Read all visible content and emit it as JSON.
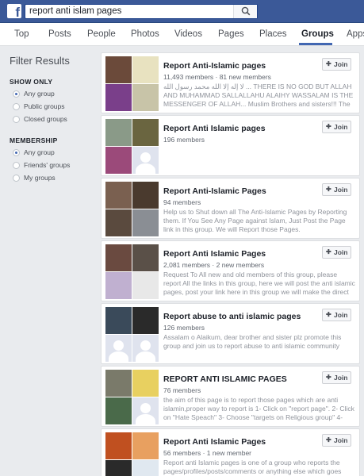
{
  "header": {
    "logo": "f",
    "search_value": "report anti islam pages"
  },
  "tabs": [
    "Top",
    "Posts",
    "People",
    "Photos",
    "Videos",
    "Pages",
    "Places",
    "Groups",
    "Apps"
  ],
  "active_tab": "Groups",
  "sidebar": {
    "title": "Filter Results",
    "show_only": {
      "heading": "SHOW ONLY",
      "options": [
        "Any group",
        "Public groups",
        "Closed groups"
      ],
      "selected": "Any group"
    },
    "membership": {
      "heading": "MEMBERSHIP",
      "options": [
        "Any group",
        "Friends' groups",
        "My groups"
      ],
      "selected": "Any group"
    }
  },
  "join_label": "Join",
  "results": [
    {
      "title": "Report Anti-Islamic pages",
      "meta": "11,493 members · 81 new members",
      "description": "لا إله إلا الله محمد رسول الله ... THERE IS NO GOD BUT ALLAH AND MUHAMMAD SALLALLAHU ALAIHY WASSALAM IS THE MESSENGER OF ALLAH... Muslim Brothers and sisters!!! The Mai...",
      "thumbs": [
        "#6b4a3a",
        "#e8e2c0",
        "#7a3f8a",
        "#c8c4a8"
      ]
    },
    {
      "title": "Report Anti Islamic pages",
      "meta": "196 members",
      "description": "",
      "thumbs": [
        "#8a9a88",
        "#6a6540",
        "#9b4a7a",
        "silhouette"
      ]
    },
    {
      "title": "Report Anti-Islamic Pages",
      "meta": "94 members",
      "description": "Help us to Shut down all The Anti-Islamic Pages by Reporting them. If You See Any Page against Islam, Just Post the Page link in this group. We will Report those Pages.",
      "thumbs": [
        "#7a6050",
        "#4a3a2e",
        "#5a4a3e",
        "#8a8e94"
      ]
    },
    {
      "title": "Report Anti Islamic Pages",
      "meta": "2,081 members · 2 new members",
      "description": "Request To All new and old members of this group, please report All the links in this group, here we will post the anti islamic pages, post your link here in this group we will make the direct report link ...",
      "thumbs": [
        "#6a4a40",
        "#5a5048",
        "#c0b0d0",
        "#e8e8e8"
      ]
    },
    {
      "title": "Report abuse to anti islamic pages",
      "meta": "126 members",
      "description": "Assalam o Alaikum, dear brother and sister plz promote this group and join us to report abuse to anti islamic community",
      "thumbs": [
        "#3a4a5a",
        "#2a2a2a",
        "silhouette",
        "silhouette"
      ]
    },
    {
      "title": "REPORT ANTI ISLAMIC PAGES",
      "meta": "76 members",
      "description": "the aim of this page is to report those pages which are anti islamin,proper way to report is 1- Click on \"report page\". 2- Click on \"Hate Speach\" 3- Choose \"targets on Religious group\" 4- Click on...",
      "thumbs": [
        "#7a7a6a",
        "#e8d060",
        "#4a6a4a",
        "silhouette"
      ]
    },
    {
      "title": "Report Anti Islamic Pages",
      "meta": "56 members · 1 new member",
      "description": "Report anti Islamic pages is one of a group who reports the pages/profiles/posts/comments or anything else which goes against...",
      "thumbs": [
        "#c05020",
        "#e8a060",
        "#2a2a2a",
        "#e0e8f0"
      ]
    }
  ],
  "colors": {
    "brand": "#3b5998",
    "background": "#e9ebee",
    "accent": "#4267b2"
  }
}
